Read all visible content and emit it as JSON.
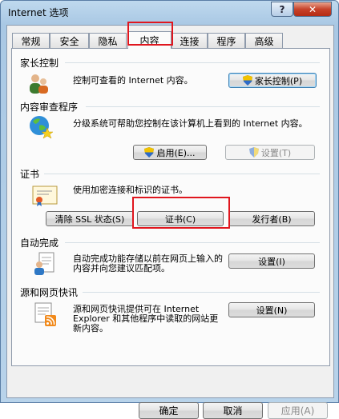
{
  "window": {
    "title": "Internet 选项",
    "help_label": "?",
    "close_label": "✕"
  },
  "tabs": [
    {
      "label": "常规"
    },
    {
      "label": "安全"
    },
    {
      "label": "隐私"
    },
    {
      "label": "内容",
      "active": true
    },
    {
      "label": "连接"
    },
    {
      "label": "程序"
    },
    {
      "label": "高级"
    }
  ],
  "sections": {
    "parental": {
      "label": "家长控制",
      "description": "控制可查看的 Internet 内容。",
      "button": "家长控制(P)"
    },
    "advisor": {
      "label": "内容审查程序",
      "description": "分级系统可帮助您控制在该计算机上看到的 Internet 内容。",
      "enable_button": "启用(E)...",
      "settings_button": "设置(T)"
    },
    "certificates": {
      "label": "证书",
      "description": "使用加密连接和标识的证书。",
      "clear_ssl_button": "清除 SSL 状态(S)",
      "certificates_button": "证书(C)",
      "publishers_button": "发行者(B)"
    },
    "autocomplete": {
      "label": "自动完成",
      "description": "自动完成功能存储以前在网页上输入的内容并向您建议匹配项。",
      "settings_button": "设置(I)"
    },
    "feeds": {
      "label": "源和网页快讯",
      "description": "源和网页快讯提供可在 Internet Explorer 和其他程序中读取的网站更新内容。",
      "settings_button": "设置(N)"
    }
  },
  "footer": {
    "ok": "确定",
    "cancel": "取消",
    "apply": "应用(A)"
  },
  "colors": {
    "highlight": "#e0161e",
    "window_frame": "#a9c8e4",
    "close_button": "#c7422a"
  }
}
